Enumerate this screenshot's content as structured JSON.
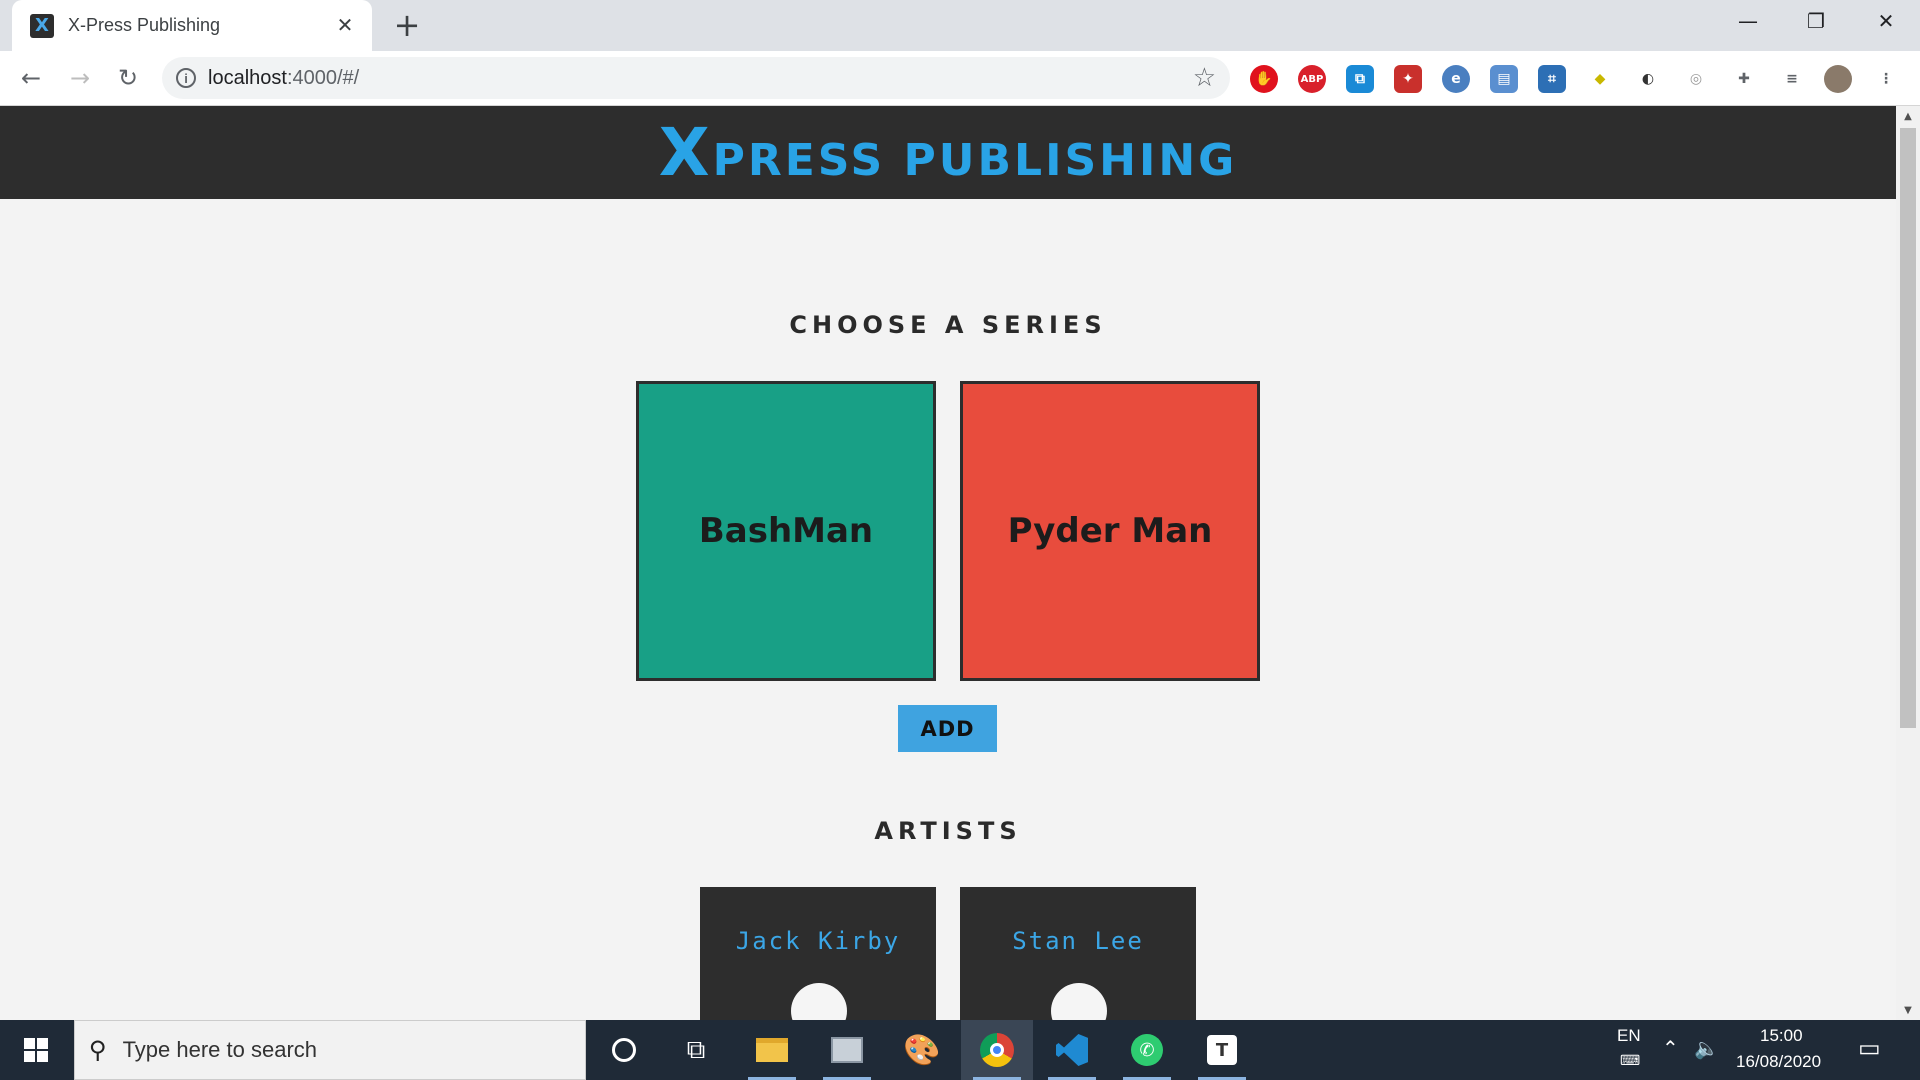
{
  "browser": {
    "tab_title": "X-Press Publishing",
    "tab_favicon": "X",
    "tab_close": "✕",
    "new_tab": "+",
    "url_host": "localhost",
    "url_rest": ":4000/#/",
    "window_minimize": "—",
    "window_restore": "❐",
    "window_close": "✕",
    "extensions": [
      "stop-icon",
      "adblock-plus-icon",
      "cast-icon",
      "extension-red-icon",
      "ie-tab-icon",
      "extension-calendar-icon",
      "crop-icon",
      "pin-icon",
      "dark-mode-icon",
      "circle-icon",
      "puzzle-icon",
      "playlist-icon"
    ],
    "abp_label": "ABP"
  },
  "site": {
    "logo_x": "X",
    "logo_rest": "press publishing",
    "logo_color": "#29a3e6",
    "header_bg": "#2d2d2d"
  },
  "series_section": {
    "title": "CHOOSE A SERIES",
    "items": [
      {
        "name": "BashMan",
        "color": "#18a086"
      },
      {
        "name": "Pyder Man",
        "color": "#e84c3d"
      }
    ],
    "add_label": "ADD",
    "add_color": "#3fa3e0"
  },
  "artists_section": {
    "title": "ARTISTS",
    "items": [
      {
        "name": "Jack Kirby"
      },
      {
        "name": "Stan Lee"
      }
    ]
  },
  "taskbar": {
    "search_placeholder": "Type here to search",
    "language": "EN",
    "time": "15:00",
    "date": "16/08/2020",
    "apps": [
      "cortana-icon",
      "task-view-icon",
      "file-explorer-icon",
      "network-drive-icon",
      "paint-icon",
      "chrome-icon",
      "vscode-icon",
      "whatsapp-icon",
      "typora-icon"
    ]
  }
}
